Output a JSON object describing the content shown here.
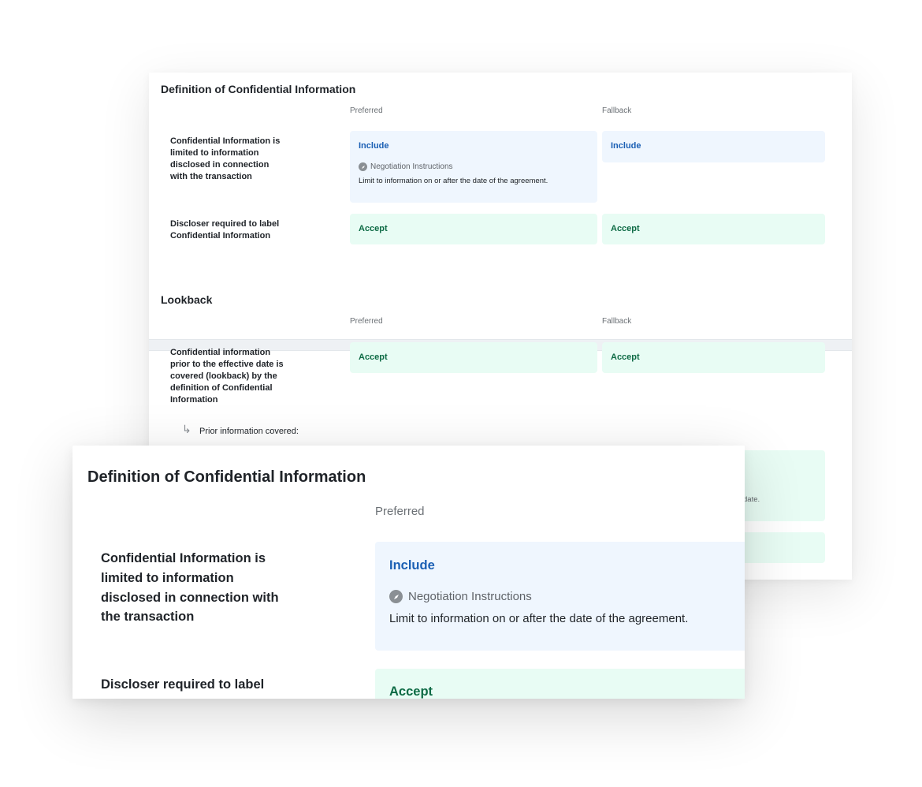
{
  "back_panel": {
    "section1": {
      "title": "Definition of Confidential Information",
      "col_preferred": "Preferred",
      "col_fallback": "Fallback",
      "row1": {
        "label": "Confidential Information is limited to information disclosed in connection with the transaction",
        "preferred_value": "Include",
        "negotiation_label": "Negotiation Instructions",
        "negotiation_note": "Limit to information on or after the date of the agreement.",
        "fallback_value": "Include"
      },
      "row2": {
        "label": "Discloser required to label Confidential Information",
        "preferred_value": "Accept",
        "fallback_value": "Accept"
      }
    },
    "section2": {
      "title": "Lookback",
      "col_preferred": "Preferred",
      "col_fallback": "Fallback",
      "row1": {
        "label": "Confidential information prior to the effective date is covered (lookback) by the definition of Confidential Information",
        "preferred_value": "Accept",
        "fallback_value": "Accept"
      },
      "sub_row": {
        "arrow": "↳",
        "label": "Prior information covered:",
        "fallback_fragment": "date."
      }
    }
  },
  "front_panel": {
    "title": "Definition of Confidential Information",
    "col_preferred": "Preferred",
    "row1": {
      "label": "Confidential Information is limited to information disclosed in connection with the transaction",
      "preferred_value": "Include",
      "negotiation_label": "Negotiation Instructions",
      "negotiation_note": "Limit to information on or after the date of the agreement."
    },
    "row2": {
      "label": "Discloser required to label Confidential Information",
      "preferred_value": "Accept"
    }
  },
  "colors": {
    "include_text": "#1a5fb4",
    "accept_text": "#0e6b45",
    "include_bg": "#eff6fe",
    "accept_bg": "#e8fcf4"
  },
  "icons": {
    "negotiation": "compass-icon",
    "sub_row": "arrow-return-icon"
  }
}
